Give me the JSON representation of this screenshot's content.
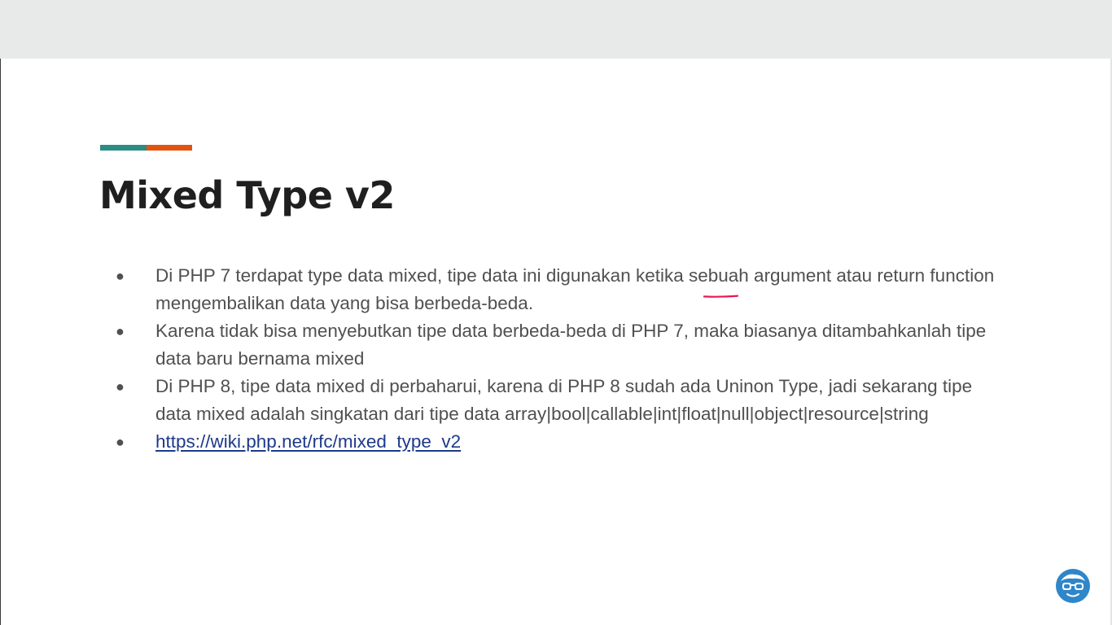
{
  "slide": {
    "title": "Mixed Type v2",
    "bullets": [
      {
        "text": "Di PHP 7 terdapat type data mixed, tipe data ini digunakan ketika sebuah argument atau return function mengembalikan data yang bisa berbeda-beda.",
        "is_link": false
      },
      {
        "text": "Karena tidak bisa menyebutkan tipe data berbeda-beda di PHP 7, maka biasanya ditambahkanlah tipe data baru bernama mixed",
        "is_link": false
      },
      {
        "text": "Di PHP 8, tipe data mixed di perbaharui, karena di PHP 8 sudah ada Uninon Type, jadi sekarang tipe data mixed adalah singkatan dari tipe data array|bool|callable|int|float|null|object|resource|string",
        "is_link": false
      },
      {
        "text": "https://wiki.php.net/rfc/mixed_type_v2",
        "is_link": true
      }
    ]
  },
  "colors": {
    "accent_teal": "#2a8c82",
    "accent_orange": "#e2530f",
    "title": "#1f1f1f",
    "body_text": "#505050",
    "link": "#1d3a8a",
    "pen_stroke": "#e8194f",
    "logo_blue": "#2f86c9"
  },
  "icons": {
    "bullet": "filled-circle",
    "logo": "glasses-face-logo-icon"
  }
}
